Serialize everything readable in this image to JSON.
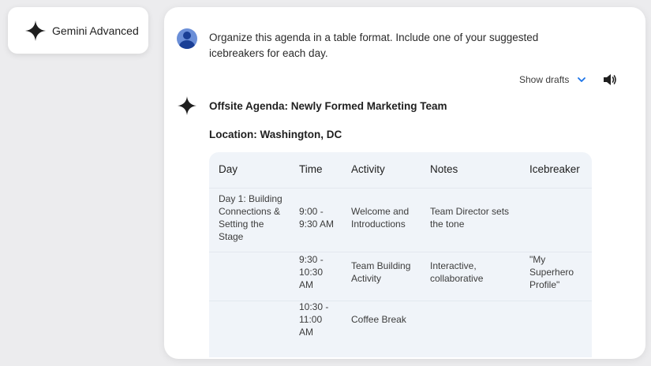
{
  "brand": {
    "name": "Gemini Advanced"
  },
  "prompt": {
    "text": "Organize this agenda in a table format. Include one of your suggested icebreakers for each day."
  },
  "controls": {
    "show_drafts": "Show drafts"
  },
  "response": {
    "title": "Offsite Agenda: Newly Formed Marketing Team",
    "location": "Location: Washington, DC"
  },
  "table": {
    "headers": [
      "Day",
      "Time",
      "Activity",
      "Notes",
      "Icebreaker"
    ],
    "rows": [
      {
        "day": "Day 1: Building Connections & Setting the Stage",
        "time": "9:00 - 9:30 AM",
        "activity": "Welcome and Introductions",
        "notes": "Team Director sets the tone",
        "icebreaker": ""
      },
      {
        "day": "",
        "time": "9:30 - 10:30 AM",
        "activity": "Team Building Activity",
        "notes": "Interactive, collaborative",
        "icebreaker": "\"My Superhero Profile\""
      },
      {
        "day": "",
        "time": "10:30 - 11:00 AM",
        "activity": "Coffee Break",
        "notes": "",
        "icebreaker": ""
      }
    ]
  },
  "colors": {
    "spark": "#1f1f1f",
    "accent_blue": "#1a73e8",
    "table_bg": "#f0f4f9",
    "avatar_bg": "#6b8fd8"
  },
  "icons": [
    "gemini-spark-icon",
    "user-avatar-icon",
    "chevron-down-icon",
    "speaker-icon"
  ]
}
